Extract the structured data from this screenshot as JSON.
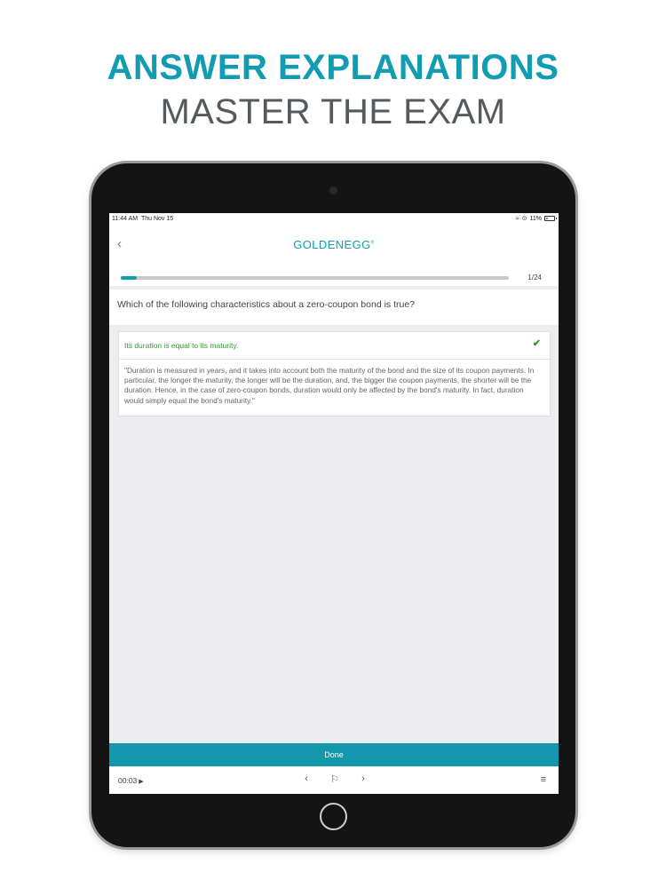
{
  "marketing": {
    "headline": "ANSWER EXPLANATIONS",
    "subheadline": "MASTER THE EXAM"
  },
  "status_bar": {
    "time": "11:44 AM",
    "date": "Thu Nov 15",
    "battery": "11%",
    "icons": [
      "wifi-icon",
      "orientation-lock-icon",
      "battery-icon"
    ]
  },
  "nav": {
    "back_icon": "chevron-left-icon",
    "logo": "GOLDENEGG"
  },
  "progress": {
    "current": 1,
    "total": 24,
    "label": "1/24",
    "fraction": 0.042,
    "color": "#119cb1"
  },
  "question": {
    "text": "Which of the following characteristics about a zero-coupon bond is true?"
  },
  "answer": {
    "text": "Its duration is equal to its maturity.",
    "status": "correct",
    "color": "#2b9a2e",
    "icon": "check-icon",
    "explanation": "\"Duration is measured in years, and it takes into account both the maturity of the bond and the size of its coupon payments. In particular, the longer the maturity, the longer will be the duration, and, the bigger the coupon payments, the shorter will be the duration. Hence, in the case of zero-coupon bonds, duration would only be affected by the bond's maturity. In fact, duration would simply equal the bond's maturity.\""
  },
  "done_button": {
    "label": "Done",
    "color": "#1397ac"
  },
  "bottom_bar": {
    "timer": "00:03",
    "icons": [
      "play-icon",
      "previous-icon",
      "flag-icon",
      "next-icon",
      "menu-icon"
    ]
  }
}
